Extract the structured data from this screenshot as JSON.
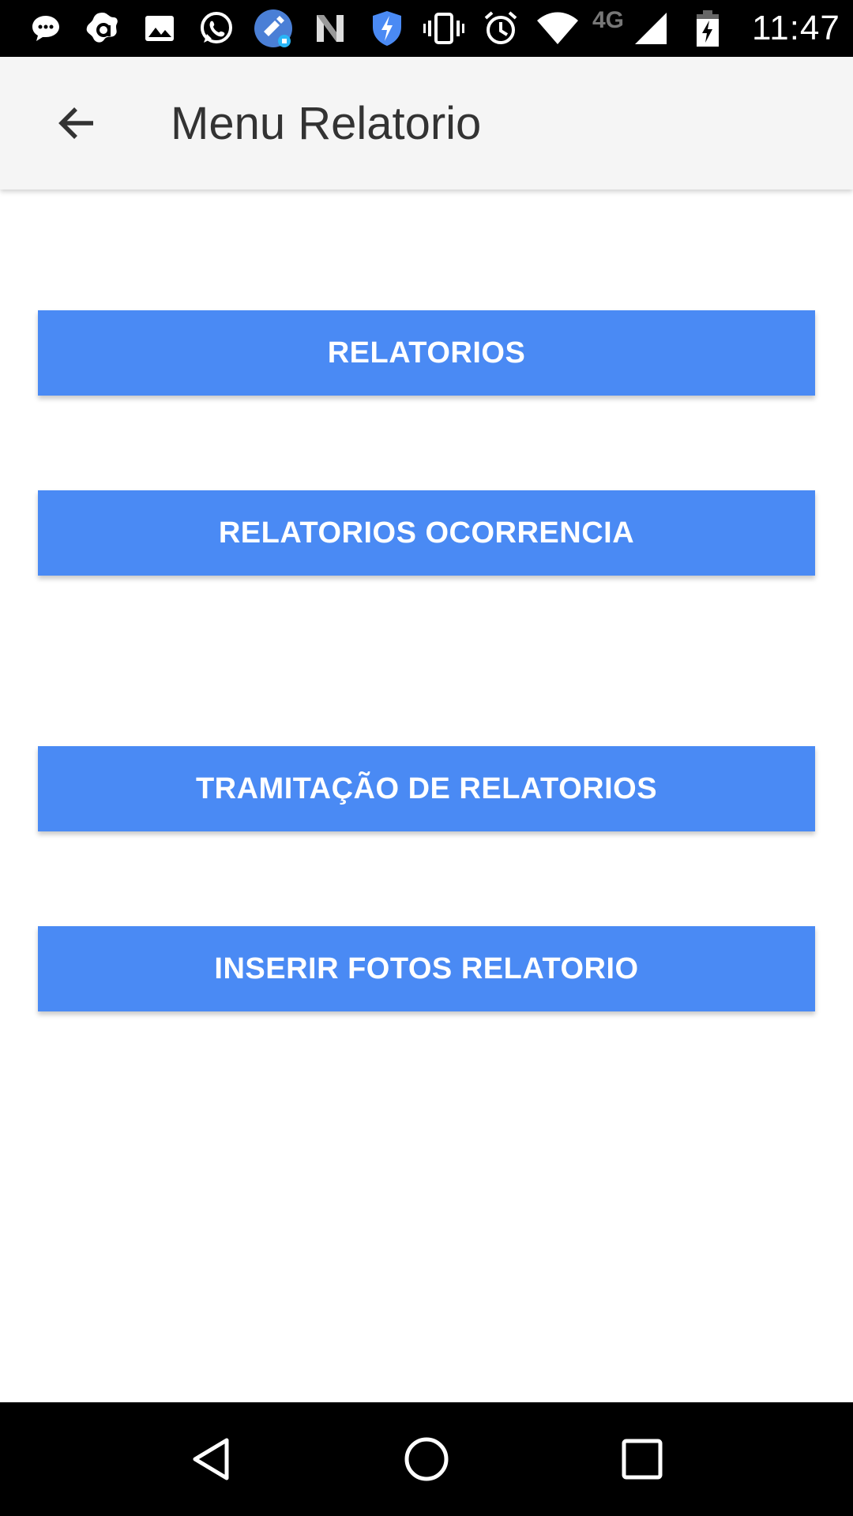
{
  "status_bar": {
    "icons": [
      "chat-bubble-icon",
      "app-a-icon",
      "image-icon",
      "whatsapp-icon",
      "cleaner-icon",
      "n-app-icon",
      "shield-icon",
      "vibrate-icon",
      "alarm-icon",
      "wifi-icon"
    ],
    "network_label": "4G",
    "time": "11:47"
  },
  "app_bar": {
    "title": "Menu Relatorio",
    "back_icon": "arrow-left-icon"
  },
  "buttons": [
    {
      "label": "RELATORIOS"
    },
    {
      "label": "RELATORIOS OCORRENCIA"
    },
    {
      "label": "TRAMITAÇÃO DE RELATORIOS"
    },
    {
      "label": "INSERIR FOTOS RELATORIO"
    }
  ],
  "colors": {
    "button_bg": "#4a8af4",
    "app_bar_bg": "#f5f5f5",
    "title_text": "#333333"
  },
  "nav_bar": {
    "icons": [
      "back-triangle-icon",
      "home-circle-icon",
      "recents-square-icon"
    ]
  }
}
